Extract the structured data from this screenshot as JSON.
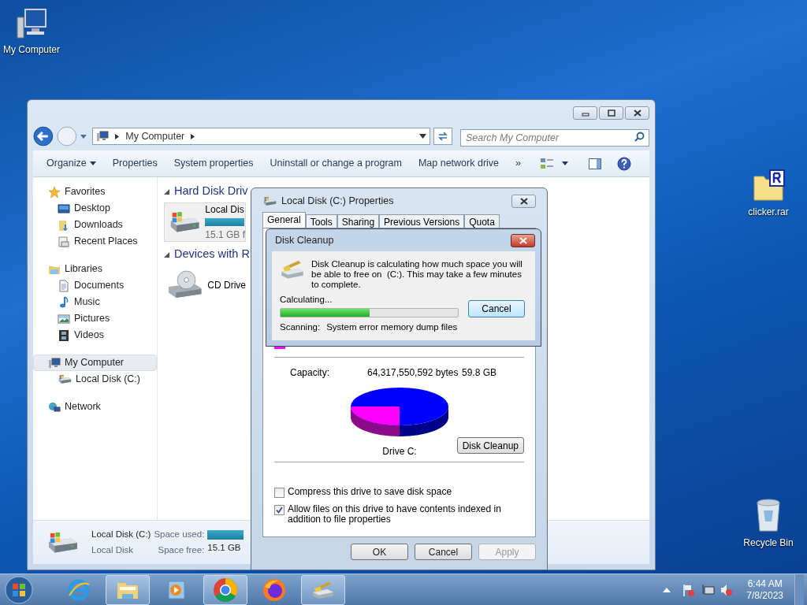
{
  "desktop_icons": [
    {
      "label": "My Computer",
      "kind": "computer"
    },
    {
      "label": "clicker.rar",
      "kind": "archive"
    },
    {
      "label": "Recycle Bin",
      "kind": "recycle-bin"
    }
  ],
  "explorer": {
    "address": {
      "path": "My Computer"
    },
    "search": {
      "placeholder": "Search My Computer"
    },
    "toolbar": [
      {
        "label": "Organize",
        "kind": "menu"
      },
      {
        "label": "Properties",
        "kind": "button"
      },
      {
        "label": "System properties",
        "kind": "button"
      },
      {
        "label": "Uninstall or change a program",
        "kind": "button"
      },
      {
        "label": "Map network drive",
        "kind": "button"
      },
      {
        "label": "»",
        "kind": "button"
      }
    ],
    "navigation": [
      {
        "label": "Favorites",
        "kind": "star",
        "selected": false,
        "children": [
          {
            "label": "Desktop",
            "kind": "desktop",
            "selected": false
          },
          {
            "label": "Downloads",
            "kind": "download",
            "selected": false
          },
          {
            "label": "Recent Places",
            "kind": "recent",
            "selected": false
          }
        ]
      },
      {
        "label": "Libraries",
        "kind": "library",
        "selected": false,
        "children": [
          {
            "label": "Documents",
            "kind": "document",
            "selected": false
          },
          {
            "label": "Music",
            "kind": "music",
            "selected": false
          },
          {
            "label": "Pictures",
            "kind": "picture",
            "selected": false
          },
          {
            "label": "Videos",
            "kind": "video",
            "selected": false
          }
        ]
      },
      {
        "label": "My Computer",
        "kind": "computer",
        "selected": true,
        "children": [
          {
            "label": "Local Disk (C:)",
            "kind": "disk",
            "selected": false
          }
        ]
      },
      {
        "label": "Network",
        "kind": "network",
        "selected": false
      }
    ],
    "groups": [
      {
        "title": "Hard Disk Driv",
        "items": [
          {
            "name": "Local Dis",
            "detail": "15.1 GB f",
            "kind": "hard-disk"
          }
        ]
      },
      {
        "title": "Devices with R",
        "items": [
          {
            "name": "CD Drive",
            "kind": "cd-drive"
          }
        ]
      }
    ],
    "details_pane": {
      "name": "Local Disk (C:)",
      "type": "Local Disk",
      "used_label": "Space used:",
      "free_label": "Space free:",
      "free_value": "15.1 GB"
    }
  },
  "properties_dialog": {
    "title": "Local Disk (C:) Properties",
    "tabs": [
      {
        "label": "General",
        "selected": true
      },
      {
        "label": "Tools",
        "selected": false
      },
      {
        "label": "Sharing",
        "selected": false
      },
      {
        "label": "Previous Versions",
        "selected": false
      },
      {
        "label": "Quota",
        "selected": false
      }
    ],
    "capacity": {
      "label": "Capacity:",
      "bytes": "64,317,550,592 bytes",
      "size": "59.8 GB"
    },
    "drive_label": "Drive C:",
    "cleanup_button": "Disk Cleanup",
    "options": [
      {
        "label": "Compress this drive to save disk space",
        "checked": false
      },
      {
        "label": "Allow files on this drive to have contents indexed in addition to file properties",
        "checked": true
      }
    ],
    "buttons": [
      {
        "label": "OK",
        "disabled": false
      },
      {
        "label": "Cancel",
        "disabled": false
      },
      {
        "label": "Apply",
        "disabled": true
      }
    ]
  },
  "cleanup_dialog": {
    "title": "Disk Cleanup",
    "message": "Disk Cleanup is calculating how much space you will be able to free on  (C:). This may take a few minutes to complete.",
    "status": "Calculating...",
    "progress": {
      "level": 0.5
    },
    "scanning_label": "Scanning:",
    "scanning_item": "System error memory dump files",
    "cancel": "Cancel"
  },
  "taskbar": {
    "apps": [
      {
        "kind": "ie",
        "running": false
      },
      {
        "kind": "explorer",
        "running": true
      },
      {
        "kind": "media",
        "running": false
      },
      {
        "kind": "chrome",
        "running": true
      },
      {
        "kind": "firefox",
        "running": false
      },
      {
        "kind": "cleanup",
        "running": true
      }
    ],
    "clock": {
      "time": "6:44 AM",
      "date": "7/8/2023"
    }
  }
}
